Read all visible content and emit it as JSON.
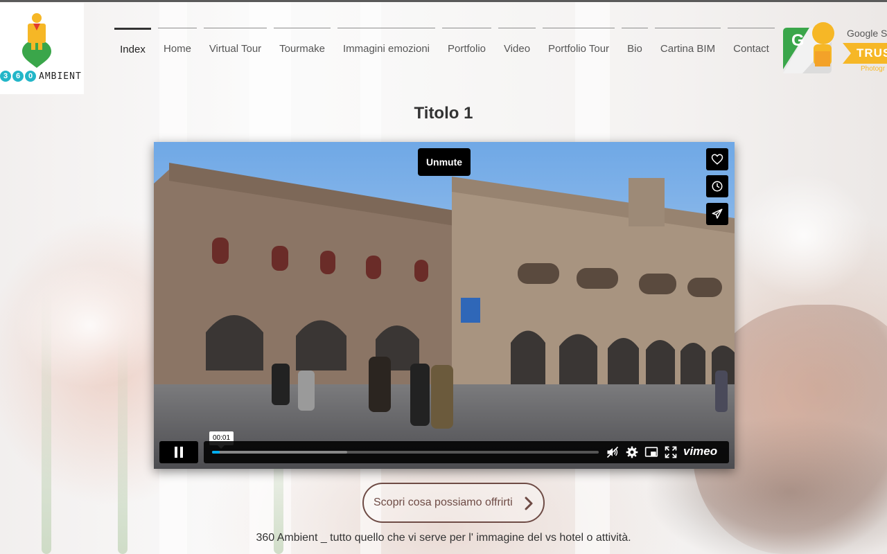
{
  "logo": {
    "digits": [
      "3",
      "6",
      "0"
    ],
    "word": "AMBIENT",
    "colors": {
      "figure_yellow": "#f6b726",
      "figure_red": "#e23b2e",
      "pin_green": "#3aa64a",
      "circle_teal": "#22b6c8"
    }
  },
  "nav": {
    "items": [
      "Index",
      "Home",
      "Virtual Tour",
      "Tourmake",
      "Immagini emozioni",
      "Portfolio",
      "Video",
      "Portfolio Tour",
      "Bio",
      "Cartina BIM",
      "Contact"
    ],
    "active": "Index"
  },
  "badge": {
    "brand_text": "Google St",
    "trust_text": "TRUS",
    "sub_text": "Photogr",
    "icon": "google-street-view-icon"
  },
  "page": {
    "title": "Titolo 1"
  },
  "video": {
    "unmute_label": "Unmute",
    "timecode": "00:01",
    "progress_played": 0.02,
    "progress_buffered": 0.35,
    "side_buttons": [
      "heart-icon",
      "clock-icon",
      "send-icon"
    ],
    "control_icons": [
      "pause-icon",
      "volume-muted-icon",
      "gear-icon",
      "pip-icon",
      "fullscreen-icon"
    ],
    "player_brand": "vimeo",
    "accent": "#00adef"
  },
  "cta": {
    "label": "Scopri cosa possiamo offrirti",
    "icon": "chevron-right-icon"
  },
  "tagline": "360 Ambient _ tutto quello che vi serve per l' immagine del vs hotel o attività."
}
